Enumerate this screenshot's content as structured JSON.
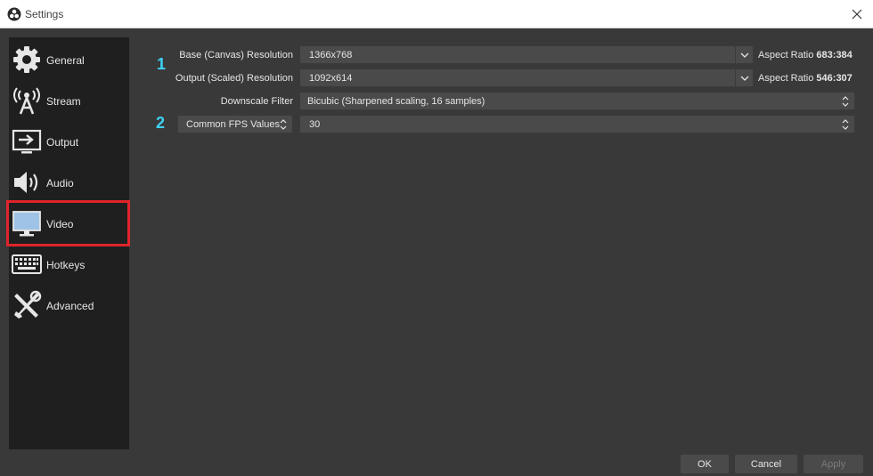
{
  "window": {
    "title": "Settings"
  },
  "sidebar": {
    "items": [
      {
        "label": "General",
        "icon": "gear-icon"
      },
      {
        "label": "Stream",
        "icon": "broadcast-tower-icon"
      },
      {
        "label": "Output",
        "icon": "output-monitor-icon"
      },
      {
        "label": "Audio",
        "icon": "speaker-icon"
      },
      {
        "label": "Video",
        "icon": "monitor-icon",
        "selected": true
      },
      {
        "label": "Hotkeys",
        "icon": "keyboard-icon"
      },
      {
        "label": "Advanced",
        "icon": "tools-icon"
      }
    ]
  },
  "video": {
    "markers": [
      "1",
      "2"
    ],
    "base_resolution": {
      "label": "Base (Canvas) Resolution",
      "value": "1366x768",
      "aspect_prefix": "Aspect Ratio",
      "aspect_value": "683:384"
    },
    "output_resolution": {
      "label": "Output (Scaled) Resolution",
      "value": "1092x614",
      "aspect_prefix": "Aspect Ratio",
      "aspect_value": "546:307"
    },
    "downscale_filter": {
      "label": "Downscale Filter",
      "value": "Bicubic (Sharpened scaling, 16 samples)"
    },
    "fps": {
      "type_value": "Common FPS Values",
      "value": "30"
    }
  },
  "buttons": {
    "ok": "OK",
    "cancel": "Cancel",
    "apply": "Apply"
  },
  "colors": {
    "accent_marker": "#3fd2f4",
    "selection_outline": "#e0242c",
    "background": "#393939",
    "sidebar": "#1f1f1f"
  }
}
